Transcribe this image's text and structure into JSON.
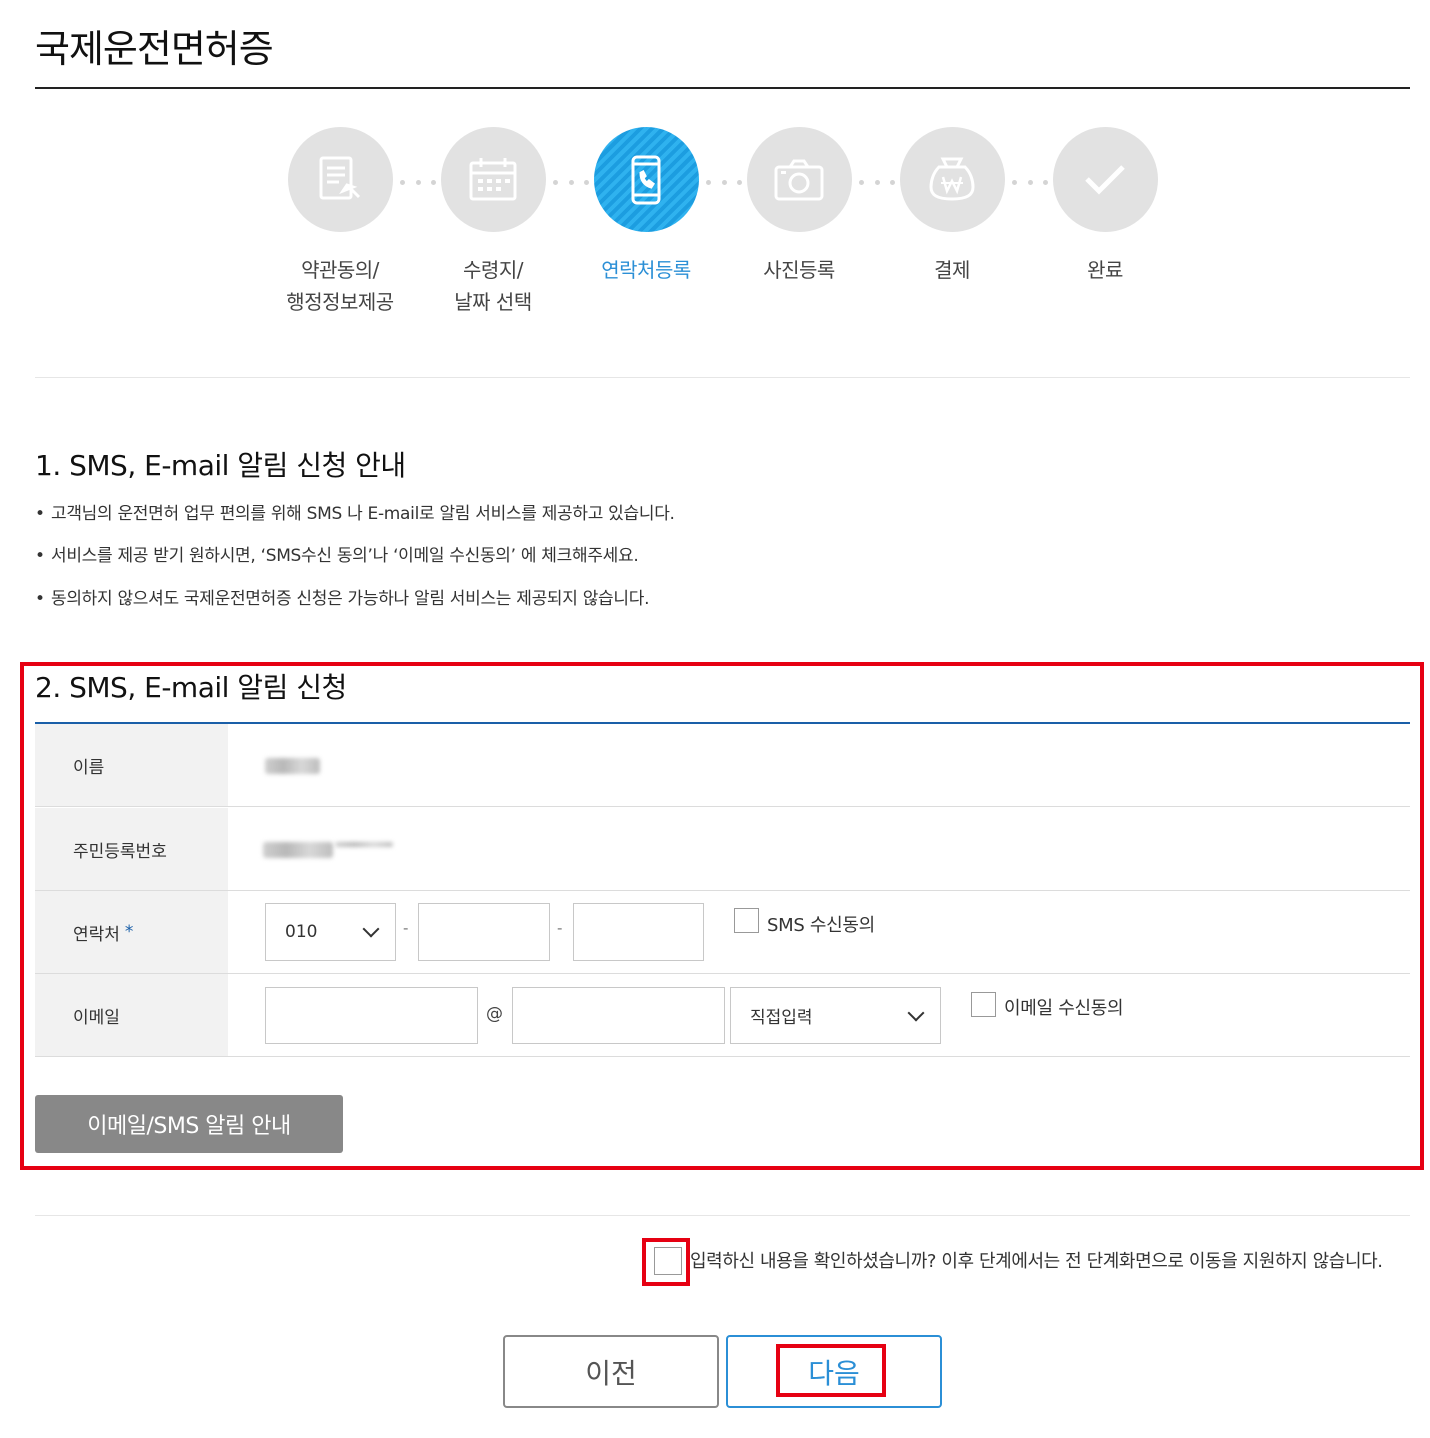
{
  "page": {
    "title": "국제운전면허증"
  },
  "steps": [
    {
      "line1": "약관동의/",
      "line2": "행정정보제공",
      "icon": "document-icon",
      "active": false
    },
    {
      "line1": "수령지/",
      "line2": "날짜 선택",
      "icon": "calendar-icon",
      "active": false
    },
    {
      "line1": "연락처등록",
      "line2": "",
      "icon": "phone-icon",
      "active": true
    },
    {
      "line1": "사진등록",
      "line2": "",
      "icon": "camera-icon",
      "active": false
    },
    {
      "line1": "결제",
      "line2": "",
      "icon": "won-bag-icon",
      "active": false
    },
    {
      "line1": "완료",
      "line2": "",
      "icon": "checkmark-icon",
      "active": false
    }
  ],
  "section1": {
    "title": "1. SMS, E-mail 알림 신청 안내",
    "bullets": [
      "고객님의 운전면허 업무 편의를 위해 SMS 나 E-mail로 알림 서비스를 제공하고 있습니다.",
      "서비스를 제공 받기 원하시면, ‘SMS수신 동의’나 ‘이메일 수신동의’ 에 체크해주세요.",
      "동의하지 않으셔도 국제운전면허증 신청은 가능하나 알림 서비스는 제공되지 않습니다."
    ]
  },
  "section2": {
    "title": "2. SMS, E-mail 알림 신청",
    "name_label": "이름",
    "rrn_label": "주민등록번호",
    "phone_label": "연락처",
    "required_mark": "*",
    "phone_prefix": "010",
    "phone_sep": "-",
    "sms_consent": "SMS 수신동의",
    "email_label": "이메일",
    "at_sign": "@",
    "email_domain_select": "직접입력",
    "email_consent": "이메일 수신동의",
    "info_button": "이메일/SMS 알림 안내"
  },
  "confirm": {
    "text": "입력하신 내용을 확인하셨습니까? 이후 단계에서는 전 단계화면으로 이동을 지원하지 않습니다."
  },
  "buttons": {
    "prev": "이전",
    "next": "다음"
  },
  "colors": {
    "accent": "#2b8fd6",
    "highlight": "#e60012",
    "step_inactive": "#e2e2e2"
  }
}
